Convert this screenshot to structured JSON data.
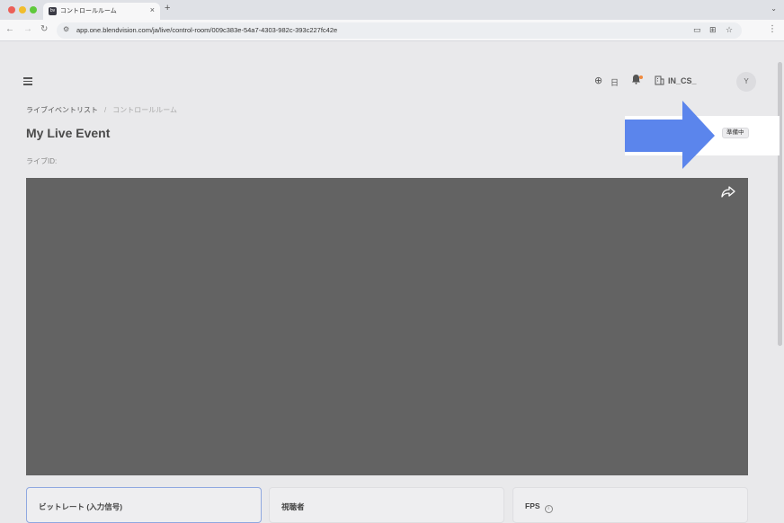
{
  "browser": {
    "tab_title": "コントロールルーム",
    "tab_close": "×",
    "new_tab": "+",
    "url": "app.one.blendvision.com/ja/live/control-room/009c383e-54a7-4303-982c-393c227fc42e"
  },
  "header": {
    "language": "日",
    "org_name": "IN_CS_",
    "avatar_initial": "Y"
  },
  "breadcrumb": {
    "parent": "ライブイベントリスト",
    "separator": "/",
    "current": "コントロールルーム"
  },
  "event": {
    "title": "My Live Event",
    "live_id_label": "ライブID:",
    "status": "準備中"
  },
  "stats": [
    {
      "label": "ビットレート (入力信号)"
    },
    {
      "label": "視聴者"
    },
    {
      "label": "FPS"
    }
  ],
  "colors": {
    "annotation_arrow": "#5b85ec",
    "player_background": "#636363"
  }
}
